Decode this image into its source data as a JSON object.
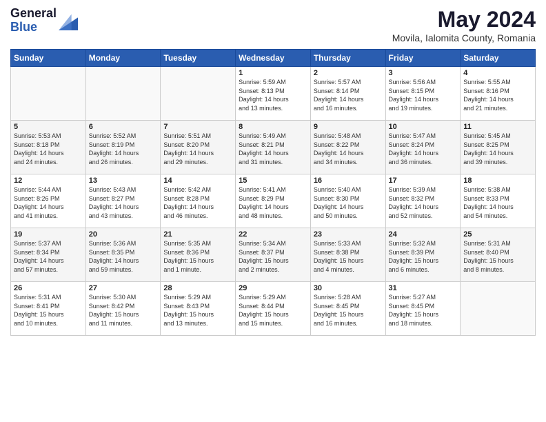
{
  "logo": {
    "general": "General",
    "blue": "Blue"
  },
  "header": {
    "title": "May 2024",
    "location": "Movila, Ialomita County, Romania"
  },
  "weekdays": [
    "Sunday",
    "Monday",
    "Tuesday",
    "Wednesday",
    "Thursday",
    "Friday",
    "Saturday"
  ],
  "weeks": [
    [
      {
        "day": "",
        "info": ""
      },
      {
        "day": "",
        "info": ""
      },
      {
        "day": "",
        "info": ""
      },
      {
        "day": "1",
        "info": "Sunrise: 5:59 AM\nSunset: 8:13 PM\nDaylight: 14 hours\nand 13 minutes."
      },
      {
        "day": "2",
        "info": "Sunrise: 5:57 AM\nSunset: 8:14 PM\nDaylight: 14 hours\nand 16 minutes."
      },
      {
        "day": "3",
        "info": "Sunrise: 5:56 AM\nSunset: 8:15 PM\nDaylight: 14 hours\nand 19 minutes."
      },
      {
        "day": "4",
        "info": "Sunrise: 5:55 AM\nSunset: 8:16 PM\nDaylight: 14 hours\nand 21 minutes."
      }
    ],
    [
      {
        "day": "5",
        "info": "Sunrise: 5:53 AM\nSunset: 8:18 PM\nDaylight: 14 hours\nand 24 minutes."
      },
      {
        "day": "6",
        "info": "Sunrise: 5:52 AM\nSunset: 8:19 PM\nDaylight: 14 hours\nand 26 minutes."
      },
      {
        "day": "7",
        "info": "Sunrise: 5:51 AM\nSunset: 8:20 PM\nDaylight: 14 hours\nand 29 minutes."
      },
      {
        "day": "8",
        "info": "Sunrise: 5:49 AM\nSunset: 8:21 PM\nDaylight: 14 hours\nand 31 minutes."
      },
      {
        "day": "9",
        "info": "Sunrise: 5:48 AM\nSunset: 8:22 PM\nDaylight: 14 hours\nand 34 minutes."
      },
      {
        "day": "10",
        "info": "Sunrise: 5:47 AM\nSunset: 8:24 PM\nDaylight: 14 hours\nand 36 minutes."
      },
      {
        "day": "11",
        "info": "Sunrise: 5:45 AM\nSunset: 8:25 PM\nDaylight: 14 hours\nand 39 minutes."
      }
    ],
    [
      {
        "day": "12",
        "info": "Sunrise: 5:44 AM\nSunset: 8:26 PM\nDaylight: 14 hours\nand 41 minutes."
      },
      {
        "day": "13",
        "info": "Sunrise: 5:43 AM\nSunset: 8:27 PM\nDaylight: 14 hours\nand 43 minutes."
      },
      {
        "day": "14",
        "info": "Sunrise: 5:42 AM\nSunset: 8:28 PM\nDaylight: 14 hours\nand 46 minutes."
      },
      {
        "day": "15",
        "info": "Sunrise: 5:41 AM\nSunset: 8:29 PM\nDaylight: 14 hours\nand 48 minutes."
      },
      {
        "day": "16",
        "info": "Sunrise: 5:40 AM\nSunset: 8:30 PM\nDaylight: 14 hours\nand 50 minutes."
      },
      {
        "day": "17",
        "info": "Sunrise: 5:39 AM\nSunset: 8:32 PM\nDaylight: 14 hours\nand 52 minutes."
      },
      {
        "day": "18",
        "info": "Sunrise: 5:38 AM\nSunset: 8:33 PM\nDaylight: 14 hours\nand 54 minutes."
      }
    ],
    [
      {
        "day": "19",
        "info": "Sunrise: 5:37 AM\nSunset: 8:34 PM\nDaylight: 14 hours\nand 57 minutes."
      },
      {
        "day": "20",
        "info": "Sunrise: 5:36 AM\nSunset: 8:35 PM\nDaylight: 14 hours\nand 59 minutes."
      },
      {
        "day": "21",
        "info": "Sunrise: 5:35 AM\nSunset: 8:36 PM\nDaylight: 15 hours\nand 1 minute."
      },
      {
        "day": "22",
        "info": "Sunrise: 5:34 AM\nSunset: 8:37 PM\nDaylight: 15 hours\nand 2 minutes."
      },
      {
        "day": "23",
        "info": "Sunrise: 5:33 AM\nSunset: 8:38 PM\nDaylight: 15 hours\nand 4 minutes."
      },
      {
        "day": "24",
        "info": "Sunrise: 5:32 AM\nSunset: 8:39 PM\nDaylight: 15 hours\nand 6 minutes."
      },
      {
        "day": "25",
        "info": "Sunrise: 5:31 AM\nSunset: 8:40 PM\nDaylight: 15 hours\nand 8 minutes."
      }
    ],
    [
      {
        "day": "26",
        "info": "Sunrise: 5:31 AM\nSunset: 8:41 PM\nDaylight: 15 hours\nand 10 minutes."
      },
      {
        "day": "27",
        "info": "Sunrise: 5:30 AM\nSunset: 8:42 PM\nDaylight: 15 hours\nand 11 minutes."
      },
      {
        "day": "28",
        "info": "Sunrise: 5:29 AM\nSunset: 8:43 PM\nDaylight: 15 hours\nand 13 minutes."
      },
      {
        "day": "29",
        "info": "Sunrise: 5:29 AM\nSunset: 8:44 PM\nDaylight: 15 hours\nand 15 minutes."
      },
      {
        "day": "30",
        "info": "Sunrise: 5:28 AM\nSunset: 8:45 PM\nDaylight: 15 hours\nand 16 minutes."
      },
      {
        "day": "31",
        "info": "Sunrise: 5:27 AM\nSunset: 8:45 PM\nDaylight: 15 hours\nand 18 minutes."
      },
      {
        "day": "",
        "info": ""
      }
    ]
  ]
}
